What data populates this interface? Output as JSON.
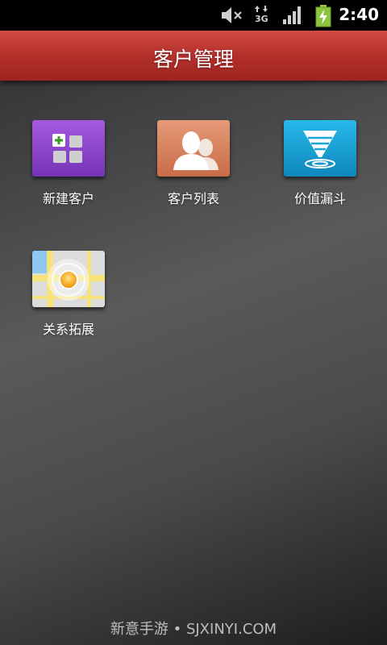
{
  "status_bar": {
    "time": "2:40",
    "icons": [
      "mute-icon",
      "data-3g-icon",
      "signal-icon",
      "battery-charging-icon"
    ],
    "network_label": "3G"
  },
  "header": {
    "title": "客户管理",
    "color": "#b5302b"
  },
  "apps": [
    {
      "label": "新建客户",
      "icon": "new-customer-icon",
      "color": "#8a44c8"
    },
    {
      "label": "客户列表",
      "icon": "customer-list-icon",
      "color": "#d9825e"
    },
    {
      "label": "价值漏斗",
      "icon": "value-funnel-icon",
      "color": "#1aa6d9"
    },
    {
      "label": "关系拓展",
      "icon": "relationship-map-icon",
      "color": "#e6e6e6"
    }
  ],
  "watermark": "新意手游 • SJXINYI.COM"
}
